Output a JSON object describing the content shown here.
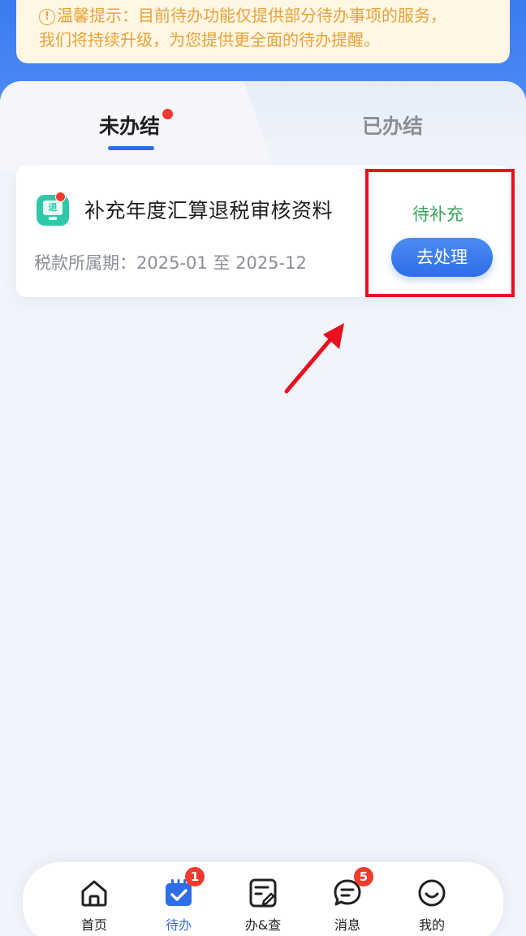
{
  "notice": {
    "icon": "info-circle-icon",
    "text_line1": "温馨提示：目前待办功能仅提供部分待办事项的服务，",
    "text_line2": "我们将持续升级，为您提供更全面的待办提醒。"
  },
  "tabs": {
    "unfinished": "未办结",
    "finished": "已办结"
  },
  "card": {
    "icon_text": "退",
    "title": "补充年度汇算退税审核资料",
    "period": "税款所属期：2025-01 至 2025-12",
    "status": "待补充",
    "action_label": "去处理"
  },
  "bottom_nav": {
    "items": [
      {
        "label": "首页",
        "icon": "home-icon"
      },
      {
        "label": "待办",
        "icon": "todo-icon",
        "badge": "1"
      },
      {
        "label": "办&查",
        "icon": "handle-query-icon"
      },
      {
        "label": "消息",
        "icon": "message-icon",
        "badge": "5"
      },
      {
        "label": "我的",
        "icon": "profile-icon"
      }
    ]
  },
  "colors": {
    "accent": "#2f6ee8",
    "status_green": "#3aa55a",
    "notice_text": "#e8a23a",
    "annotation_red": "#e8101e"
  }
}
